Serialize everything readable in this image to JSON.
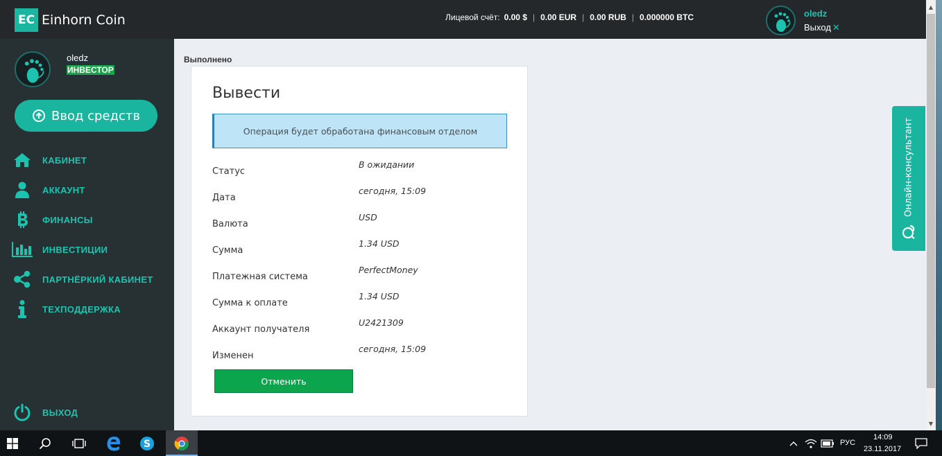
{
  "header": {
    "logo_mark": "EC",
    "logo_text": "Einhorn Coin",
    "balance_label": "Лицевой счёт:",
    "balances": [
      "0.00 $",
      "0.00 EUR",
      "0.00 RUB",
      "0.000000 BTC"
    ],
    "username": "oledz",
    "logout_label": "Выход",
    "logout_mark": "✕"
  },
  "sidebar": {
    "username": "oledz",
    "role": "ИНВЕСТОР",
    "deposit_label": "Ввод средств",
    "items": [
      {
        "label": "КАБИНЕТ",
        "icon": "home-icon"
      },
      {
        "label": "АККАУНТ",
        "icon": "user-icon"
      },
      {
        "label": "ФИНАНСЫ",
        "icon": "bitcoin-icon"
      },
      {
        "label": "ИНВЕСТИЦИИ",
        "icon": "bar-chart-icon"
      },
      {
        "label": "ПАРТНЁРКИЙ КАБИНЕТ",
        "icon": "share-icon"
      },
      {
        "label": "ТЕХПОДДЕРЖКА",
        "icon": "info-icon"
      }
    ],
    "exit_label": "ВЫХОД"
  },
  "main": {
    "breadcrumb": "Выполнено",
    "card": {
      "title": "Вывести",
      "notice": "Операция будет обработана финансовым отделом",
      "rows": [
        {
          "label": "Статус",
          "value": "В ожидании"
        },
        {
          "label": "Дата",
          "value": "сегодня, 15:09"
        },
        {
          "label": "Валюта",
          "value": "USD"
        },
        {
          "label": "Сумма",
          "value": "1.34 USD"
        },
        {
          "label": "Платежная система",
          "value": "PerfectMoney"
        },
        {
          "label": "Сумма к оплате",
          "value": "1.34 USD"
        },
        {
          "label": "Аккаунт получателя",
          "value": "U2421309"
        },
        {
          "label": "Изменен",
          "value": "сегодня, 15:09"
        }
      ],
      "cancel_label": "Отменить"
    },
    "consultant_label": "Онлайн-консультант"
  },
  "taskbar": {
    "language": "РУС",
    "time": "14:09",
    "date": "23.11.2017"
  },
  "colors": {
    "accent": "#1ab59f",
    "header_bg": "#24282b",
    "sidebar_bg": "#273134",
    "cancel_button": "#0ba54e",
    "notice_bg": "#bee5f7"
  }
}
